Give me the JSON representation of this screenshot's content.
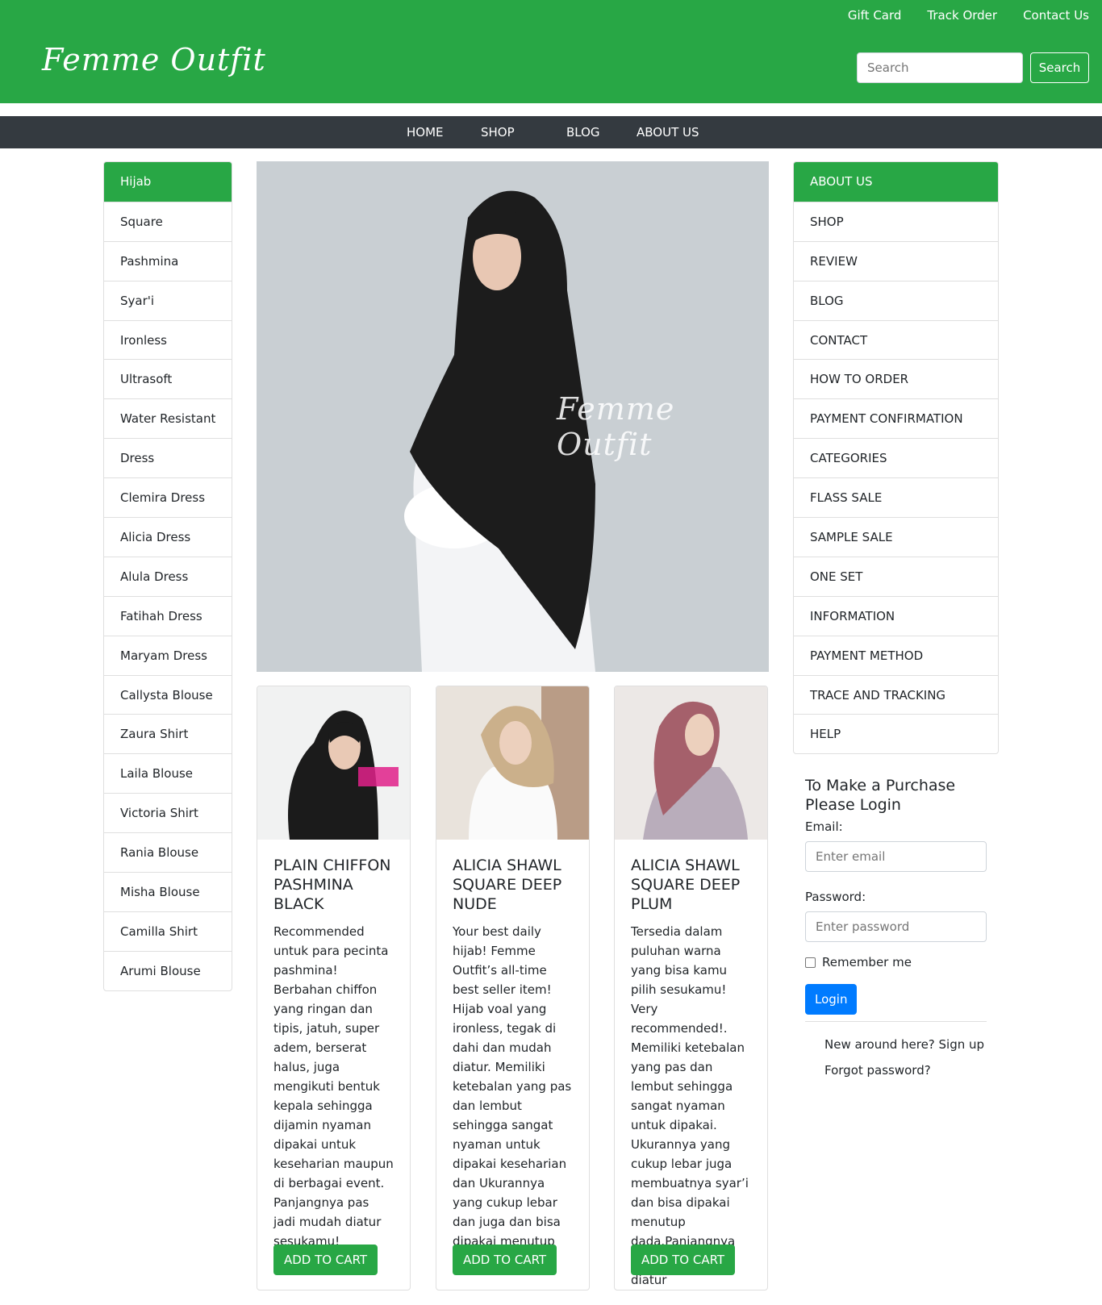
{
  "header": {
    "logo": "Femme Outfit",
    "top_links": [
      "Gift Card",
      "Track Order",
      "Contact Us"
    ],
    "search_placeholder": "Search",
    "search_button": "Search"
  },
  "nav": [
    "HOME",
    "SHOP",
    "BLOG",
    "ABOUT US"
  ],
  "left_categories": [
    "Hijab",
    "Square",
    "Pashmina",
    "Syar'i",
    "Ironless",
    "Ultrasoft",
    "Water Resistant",
    "Dress",
    "Clemira Dress",
    "Alicia Dress",
    "Alula Dress",
    "Fatihah Dress",
    "Maryam Dress",
    "Callysta Blouse",
    "Zaura Shirt",
    "Laila Blouse",
    "Victoria Shirt",
    "Rania Blouse",
    "Misha Blouse",
    "Camilla Shirt",
    "Arumi Blouse"
  ],
  "hero": {
    "watermark": "Femme Outfit"
  },
  "products": [
    {
      "title": "PLAIN CHIFFON PASHMINA BLACK",
      "description": "Recommended untuk para pecinta pashmina! Berbahan chiffon yang ringan dan tipis, jatuh, super adem, berserat halus, juga mengikuti bentuk kepala sehingga dijamin nyaman dipakai untuk keseharian maupun di berbagai event. Panjangnya pas jadi mudah diatur sesukamu!",
      "button": "ADD TO CART"
    },
    {
      "title": "ALICIA SHAWL SQUARE DEEP NUDE",
      "description": "Your best daily hijab! Femme Outfit’s all-time best seller item! Hijab voal yang ironless, tegak di dahi dan mudah diatur. Memiliki ketebalan yang pas dan lembut sehingga sangat nyaman untuk dipakai keseharian dan Ukurannya yang cukup lebar dan juga dan bisa dipakai menutup dada",
      "button": "ADD TO CART"
    },
    {
      "title": "ALICIA SHAWL SQUARE DEEP PLUM",
      "description": "Tersedia dalam puluhan warna yang bisa kamu pilih sesukamu! Very recommended!. Memiliki ketebalan yang pas dan lembut sehingga sangat nyaman untuk dipakai. Ukurannya yang cukup lebar juga membuatnya syar’i dan bisa dipakai menutup dada.Panjangnya pas jadi mudah diatur",
      "button": "ADD TO CART"
    }
  ],
  "right_menu": [
    "ABOUT US",
    "SHOP",
    "REVIEW",
    "BLOG",
    "CONTACT",
    "HOW TO ORDER",
    "PAYMENT CONFIRMATION",
    "CATEGORIES",
    "FLASS SALE",
    "SAMPLE SALE",
    "ONE SET",
    "INFORMATION",
    "PAYMENT METHOD",
    "TRACE AND TRACKING",
    "HELP"
  ],
  "login": {
    "heading": "To Make a Purchase Please Login",
    "email_label": "Email:",
    "email_placeholder": "Enter email",
    "password_label": "Password:",
    "password_placeholder": "Enter password",
    "remember": "Remember me",
    "button": "Login",
    "signup": "New around here? Sign up",
    "forgot": "Forgot password?"
  },
  "colors": {
    "brand_green": "#28a745",
    "nav_dark": "#343a40",
    "primary_blue": "#007bff"
  }
}
